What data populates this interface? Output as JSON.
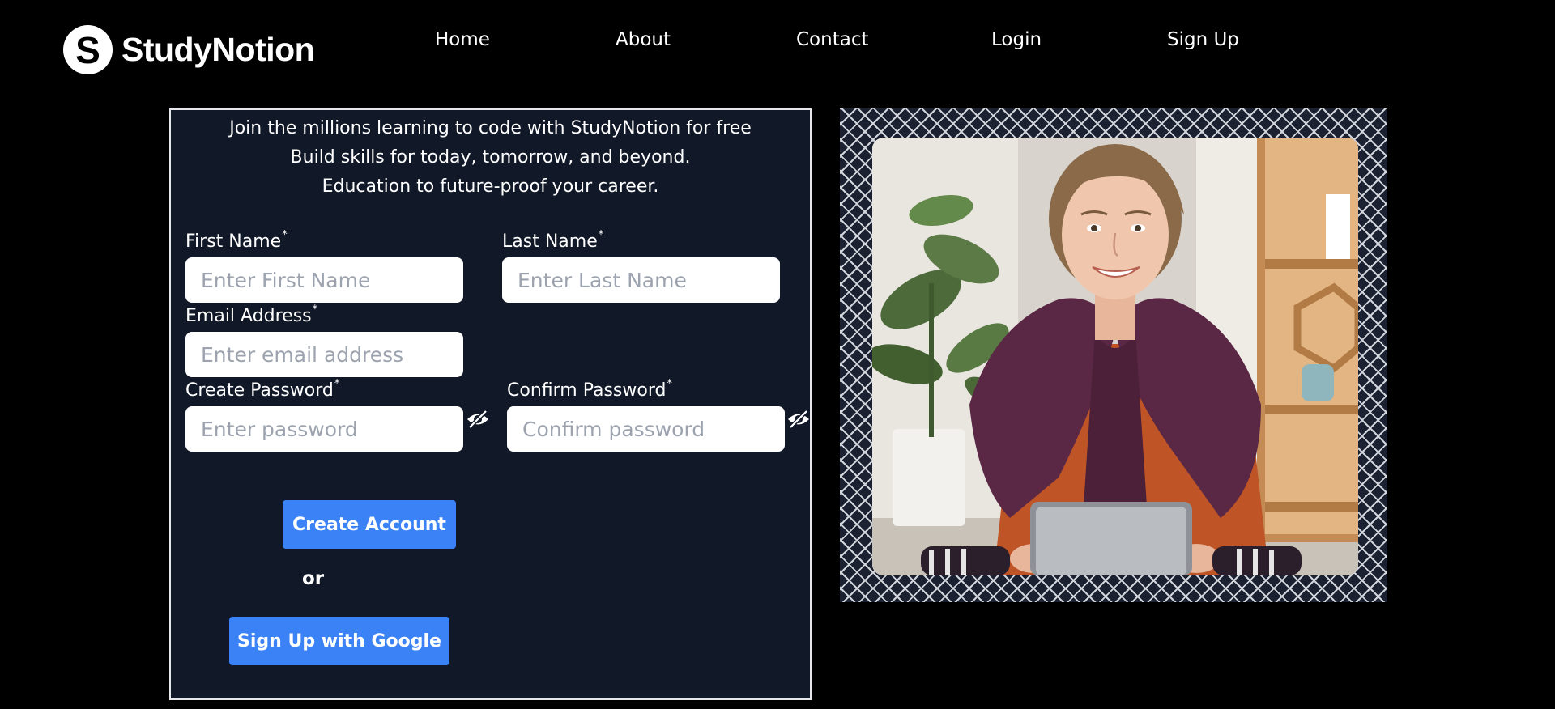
{
  "brand": {
    "logo_letter": "S",
    "name": "StudyNotion"
  },
  "nav": {
    "links": [
      {
        "label": "Home"
      },
      {
        "label": "About"
      },
      {
        "label": "Contact"
      },
      {
        "label": "Login"
      },
      {
        "label": "Sign Up"
      }
    ]
  },
  "form": {
    "taglines": [
      "Join the millions learning to code with StudyNotion for free",
      "Build skills for today, tomorrow, and beyond.",
      "Education to future-proof your career."
    ],
    "required_marker": "*",
    "first_name": {
      "label": "First Name",
      "placeholder": "Enter First Name",
      "value": ""
    },
    "last_name": {
      "label": "Last Name",
      "placeholder": "Enter Last Name",
      "value": ""
    },
    "email": {
      "label": "Email Address",
      "placeholder": "Enter email address",
      "value": ""
    },
    "password": {
      "label": "Create Password",
      "placeholder": "Enter password",
      "value": "",
      "visibility_icon": "eye-slash-icon"
    },
    "confirm_password": {
      "label": "Confirm Password",
      "placeholder": "Confirm password",
      "value": "",
      "visibility_icon": "eye-slash-icon"
    },
    "create_account_label": "Create Account",
    "or_label": "or",
    "google_label": "Sign Up with Google"
  },
  "colors": {
    "page_background": "#000000",
    "panel_background": "#111827",
    "panel_border": "#e5e7eb",
    "button_primary": "#3b82f6",
    "input_background": "#ffffff",
    "placeholder": "#9ca3af"
  }
}
